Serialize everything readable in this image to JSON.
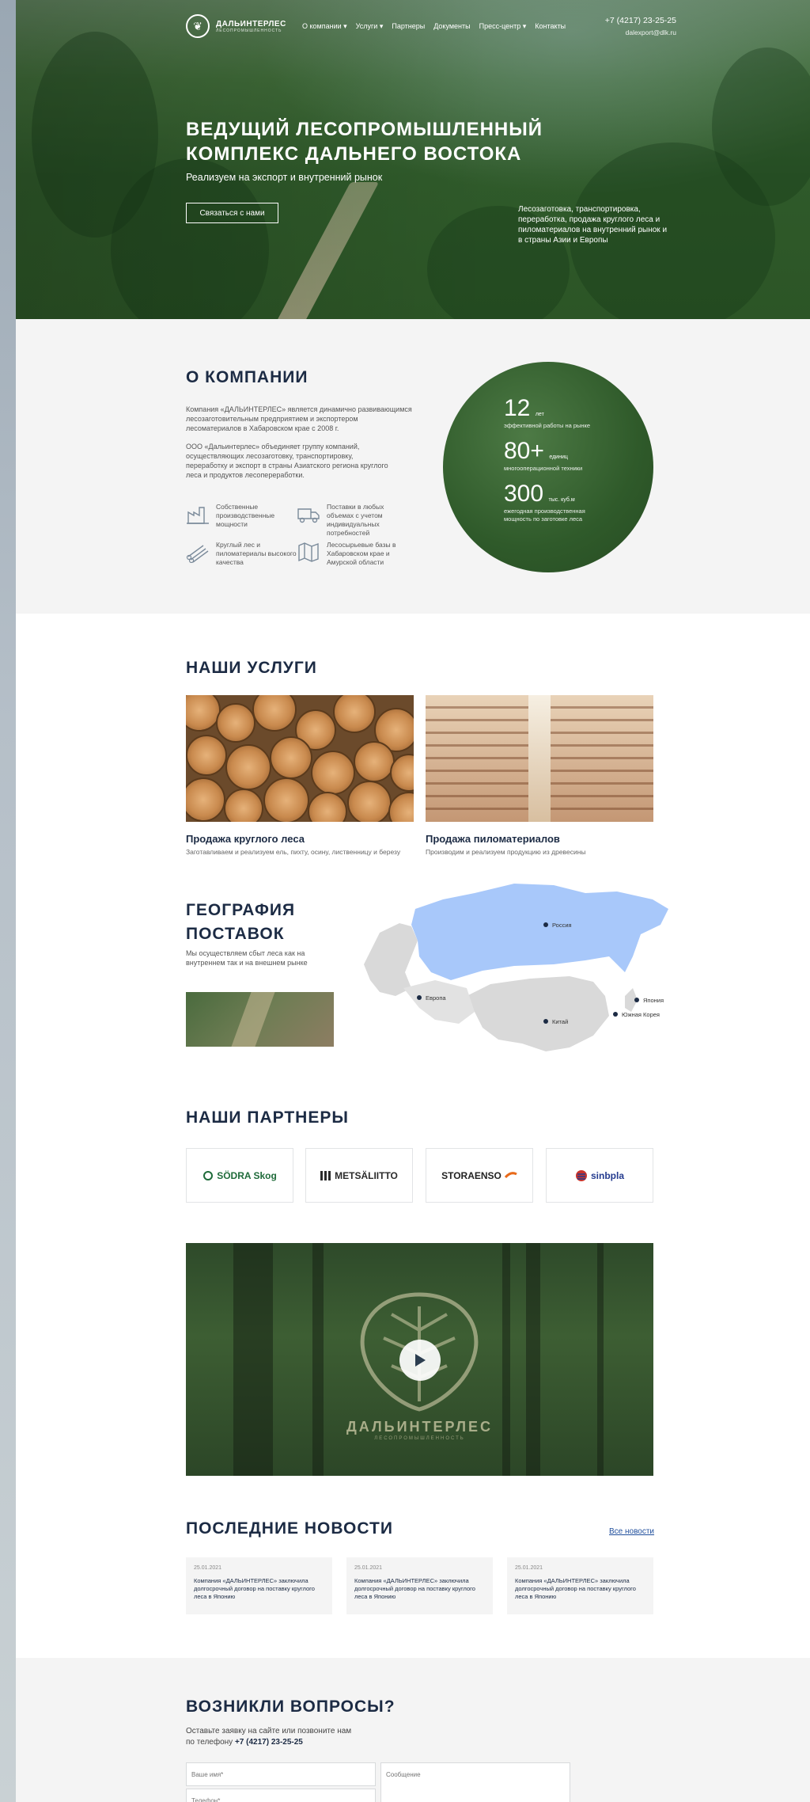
{
  "nav": {
    "logo_name": "ДАЛЬИНТЕРЛЕС",
    "logo_tagline": "ЛЕСОПРОМЫШЛЕННОСТЬ",
    "menu": [
      "О компании ▾",
      "Услуги ▾",
      "Партнеры",
      "Документы",
      "Пресс-центр ▾",
      "Контакты"
    ],
    "phone": "+7 (4217) 23-25-25",
    "email": "dalexport@dlk.ru"
  },
  "hero": {
    "title": "ВЕДУЩИЙ ЛЕСОПРОМЫШЛЕННЫЙ КОМПЛЕКС ДАЛЬНЕГО ВОСТОКА",
    "subtitle": "Реализуем на экспорт и внутренний рынок",
    "button": "Связаться с нами",
    "side_text": "Лесозаготовка, транспортировка, переработка, продажа круглого леса и пиломатериалов на внутренний рынок и в страны Азии и Европы"
  },
  "about": {
    "title": "О КОМПАНИИ",
    "p1": "Компания «ДАЛЬИНТЕРЛЕС» является динамично развивающимся лесозаготовительным предприятием и экспортером лесоматериалов в Хабаровском крае с 2008 г.",
    "p2": "ООО «Дальинтерлес» объединяет группу компаний, осуществляющих лесозаготовку, транспортировку, переработку и экспорт в страны Азиатского региона круглого леса и продуктов лесопереработки.",
    "features": [
      {
        "icon": "factory-icon",
        "text": "Собственные производственные мощности"
      },
      {
        "icon": "truck-icon",
        "text": "Поставки в любых объемах с учетом индивидуальных потребностей"
      },
      {
        "icon": "logs-icon",
        "text": "Круглый лес и пиломатериалы высокого качества"
      },
      {
        "icon": "map-icon",
        "text": "Лесосырьевые базы в Хабаровском крае и Амурской области"
      }
    ],
    "stats": [
      {
        "value": "12",
        "unit": "лет",
        "desc": "эффективной работы на рынке"
      },
      {
        "value": "80+",
        "unit": "единиц",
        "desc": "многооперационной техники"
      },
      {
        "value": "300",
        "unit": "тыс. куб.м",
        "desc": "ежегодная производственная мощность по заготовке леса"
      }
    ]
  },
  "services": {
    "title": "НАШИ УСЛУГИ",
    "items": [
      {
        "title": "Продажа круглого леса",
        "desc": "Заготавливаем и реализуем ель, пихту, осину, лиственницу и березу"
      },
      {
        "title": "Продажа пиломатериалов",
        "desc": "Производим и реализуем продукцию из древесины"
      }
    ]
  },
  "geo": {
    "title": "ГЕОГРАФИЯ ПОСТАВОК",
    "desc": "Мы осуществляем сбыт леса как на внутреннем так и на внешнем рынке",
    "labels": {
      "russia": "Россия",
      "europe": "Европа",
      "china": "Китай",
      "japan": "Япония",
      "korea": "Южная Корея"
    }
  },
  "partners": {
    "title": "НАШИ ПАРТНЕРЫ",
    "items": [
      {
        "name": "SÖDRA Skog",
        "color": "#1f6b3a"
      },
      {
        "name": "METSÄLIITTO",
        "color": "#2b2b2b"
      },
      {
        "name": "STORAENSO",
        "color": "#222222"
      },
      {
        "name": "sinbpla",
        "color": "#243b8f"
      }
    ]
  },
  "video": {
    "brand": "ДАЛЬИНТЕРЛЕС",
    "tagline": "ЛЕСОПРОМЫШЛЕННОСТЬ"
  },
  "news": {
    "title": "ПОСЛЕДНИЕ НОВОСТИ",
    "all_link": "Все новости",
    "items": [
      {
        "date": "25.01.2021",
        "text": "Компания «ДАЛЬИНТЕРЛЕС» заключила долгосрочный договор на поставку круглого леса в Японию"
      },
      {
        "date": "25.01.2021",
        "text": "Компания «ДАЛЬИНТЕРЛЕС» заключила долгосрочный договор на поставку круглого леса в Японию"
      },
      {
        "date": "25.01.2021",
        "text": "Компания «ДАЛЬИНТЕРЛЕС» заключила долгосрочный договор на поставку круглого леса в Японию"
      }
    ]
  },
  "questions": {
    "title": "ВОЗНИКЛИ ВОПРОСЫ?",
    "desc": "Оставьте заявку на сайте или позвоните нам по телефону",
    "phone": "+7 (4217) 23-25-25",
    "name_placeholder": "Ваше имя*",
    "phone_placeholder": "Телефон*",
    "message_placeholder": "Сообщение"
  },
  "colors": {
    "accent": "#1c2b44",
    "forest": "#2f5a2a",
    "map_russia": "#a8c8fa",
    "map_other": "#d9d9d9"
  }
}
